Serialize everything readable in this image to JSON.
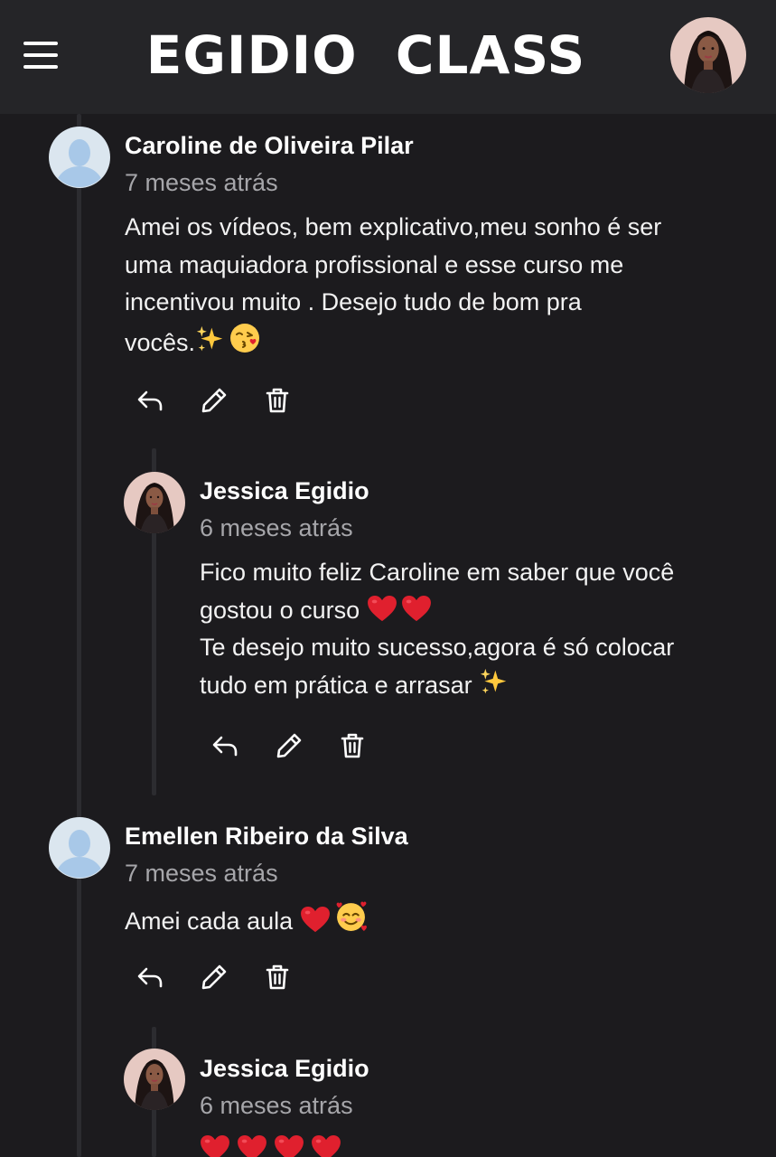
{
  "header": {
    "brand": "EGIDIO  CLASS",
    "menu_icon": "hamburger-menu-icon",
    "profile_avatar": "user-profile-photo"
  },
  "comments": [
    {
      "author": "Caroline de Oliveira Pilar",
      "time": "7 meses atrás",
      "avatar": "default-user-avatar",
      "lines": [
        "Amei os vídeos, bem explicativo,meu sonho é ser",
        "uma maquiadora profissional e esse curso me",
        "incentivou muito . Desejo tudo de bom pra",
        "vocês."
      ],
      "emoji_after": [
        "sparkles-emoji",
        "kiss-emoji"
      ],
      "actions": [
        "reply-icon",
        "edit-icon",
        "delete-icon"
      ],
      "replies": [
        {
          "author": "Jessica Egidio",
          "time": "6 meses atrás",
          "avatar": "jessica-profile-photo",
          "lines": [
            "Fico muito feliz Caroline em saber que você",
            "gostou o curso",
            "Te desejo muito sucesso,agora é só colocar",
            "tudo em prática e arrasar"
          ],
          "actions": [
            "reply-icon",
            "edit-icon",
            "delete-icon"
          ]
        }
      ]
    },
    {
      "author": "Emellen Ribeiro da Silva",
      "time": "7 meses atrás",
      "avatar": "default-user-avatar",
      "lines": [
        "Amei cada aula"
      ],
      "emoji_after": [
        "heart-emoji",
        "smiling-face-with-hearts-emoji"
      ],
      "actions": [
        "reply-icon",
        "edit-icon",
        "delete-icon"
      ],
      "replies": [
        {
          "author": "Jessica Egidio",
          "time": "6 meses atrás",
          "avatar": "jessica-profile-photo",
          "emoji_line": [
            "heart-emoji",
            "heart-emoji",
            "heart-emoji",
            "heart-emoji"
          ]
        }
      ]
    }
  ],
  "colors": {
    "background": "#1c1b1e",
    "header": "#252528",
    "text": "#ffffff",
    "muted": "#a6a6aa",
    "thread_line": "#2c2c30",
    "heart": "#e0202e"
  }
}
